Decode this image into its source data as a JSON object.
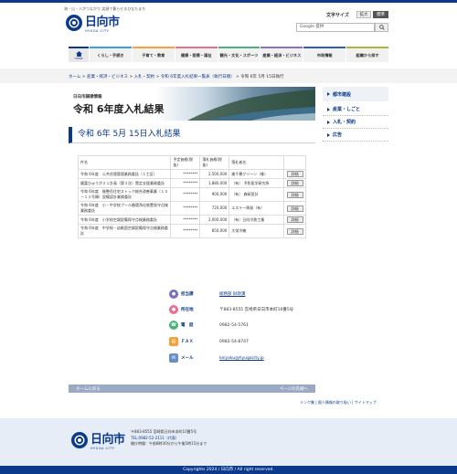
{
  "header": {
    "tagline": "海・山・人がつながり 笑顔で暮らせるひなたまち",
    "logo": "日向市",
    "logo_sub": "HYUGA CITY",
    "font_size_label": "文字サイズ",
    "font_large": "拡大",
    "font_standard": "標準",
    "search_placeholder": "Google 提供"
  },
  "nav": {
    "home": "HOME",
    "items": [
      "くらし・手続き",
      "子育て・教育",
      "健康・医療・福祉",
      "観光・文化・スポーツ",
      "産業・経済・ビジネス",
      "市政情報",
      "組織から探す"
    ]
  },
  "breadcrumb": {
    "items": [
      "ホーム",
      "産業・経済・ビジネス",
      "入札・契約",
      "令和 6年度入札結果一覧表（執行日順）"
    ],
    "current": "令和 6年 5月 15日執行"
  },
  "banner": {
    "sub": "日向市調達情報",
    "title": "令和 6年度入札結果"
  },
  "page_title": "令和 6年 5月 15日入札結果",
  "sidebar": {
    "items": [
      "都市建設",
      "産業・しごと",
      "入札・契約",
      "広告"
    ]
  },
  "table": {
    "headers": [
      "件名",
      "予定価格(税抜)",
      "落札価格(税抜)",
      "落札者名",
      ""
    ],
    "rows": [
      {
        "name": "令和 6年度　公共花壇管理業務委託（１工区）",
        "planned": "********",
        "price": "2,500,000",
        "winner": "美千穂グリーン（株）",
        "action": "詳細"
      },
      {
        "name": "國富ひゅうが２１計画（第３次）策定支援業務委託",
        "planned": "********",
        "price": "1,880,000",
        "winner": "（有） 予防医学研究所",
        "action": "詳細"
      },
      {
        "name": "令和 6年度　後整岳住宅ストック総合改善事業（１０－１３号棟）設備設計業務委託",
        "planned": "********",
        "price": "900,000",
        "winner": "（有） 森研設計",
        "action": "詳細"
      },
      {
        "name": "令和 6年度　小・中学校プール循環浄化装置保守点検業務委託",
        "planned": "********",
        "price": "720,000",
        "winner": "エステー興発（有）",
        "action": "詳細"
      },
      {
        "name": "令和 6年度　小学校空調設備保守点検業務委託",
        "planned": "********",
        "price": "2,000,000",
        "winner": "（有）日向冷熱工業",
        "action": "詳細"
      },
      {
        "name": "令和 6年度　中学校・幼稚園空調設備保守点検業務委託",
        "planned": "********",
        "price": "850,000",
        "winner": "大栄冷機",
        "action": "詳細"
      }
    ]
  },
  "contact": {
    "dept_label": "担当課",
    "dept": "総務部 財政課",
    "address_label": "所在地",
    "address": "〒883-8555 宮崎県日向市本町10番5号",
    "tel_label": "電　話",
    "tel": "0982-54-5761",
    "fax_label": "ＦＡＸ",
    "fax": "0982-54-8747",
    "mail_label": "メール",
    "mail": "keiyaku@hyugacity.jp"
  },
  "pagebar": {
    "back": "ホームに戻る",
    "top": "ページの先頭へ"
  },
  "footer": {
    "links": "リンク集 | 個人情報の取り扱い | サイトマップ",
    "logo": "日向市",
    "logo_sub": "HYUGA CITY",
    "addr1": "〒883-8555 宮崎県日向市本町10番5号",
    "addr2": "TEL:0982-52-2111（代表）",
    "addr3": "開庁時間：午前8時30分から午後5時15分まで",
    "copyright": "Copyrights 2024 / 日向市 / All right reserved."
  },
  "colors": {
    "brand": "#0b3a8c",
    "footer_bg": "#e6edf6",
    "pagebar": "#9aaac4"
  }
}
